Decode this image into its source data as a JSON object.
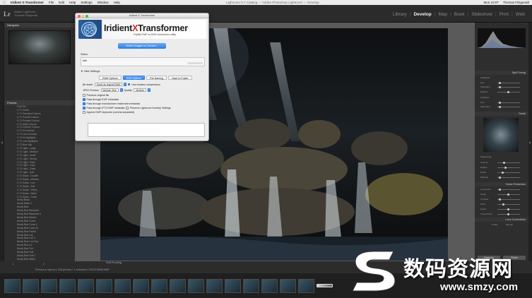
{
  "menubar": {
    "app": "Iridient X-Transformer",
    "items": [
      "File",
      "Edit",
      "Help",
      "Settings",
      "Window",
      "Help"
    ],
    "center": "Lightroom 5.7 Catalog — Adobe Photoshop Lightroom — Develop",
    "clock": "Mon 10:07",
    "user": "Thomas Fitzgerald"
  },
  "lightroom": {
    "logo": "Lr",
    "user_line1": "Adobe Lightroom",
    "user_line2": "Thomas Fitzgerald",
    "modules": [
      "Library",
      "Develop",
      "Map",
      "Book",
      "Slideshow",
      "Print",
      "Web"
    ],
    "active_module": "Develop",
    "left_panel": {
      "navigator_title": "Navigator",
      "presets_title": "Presets",
      "presets": [
        "Fuji Film",
        "X-T1 Velvia",
        "X-T1 Standard Colours",
        "X-T1 Portrait Colours",
        "X-T1 Pushed Colours",
        "X-T1 Astia Colours",
        "X-T1 Chrome Colours",
        "X-T1 Hi Contrast",
        "X-T1 Low Contrast",
        "X-T1 Hi Highlights",
        "X-T1 Low Highlights",
        "X-T1 Blue Sky",
        "X-T1 Light - Large",
        "X-T1 Light - Medium",
        "X-T1 Light - Small",
        "X-T1 Light - Strong",
        "X-T1 Light - Fade",
        "X-T1 Light - Grey",
        "X-T1 Light - Grain",
        "X-T1 Light - Soft",
        "X-T1 Sepia - Double",
        "X-T1 Sepia - Medium",
        "X-T1 Sepia - Low",
        "X-T1 Sepia - Soft",
        "X-T1 Sepia - Yellow",
        "X-T1 Sepia - Warm",
        "X-T1 Sepia - Cross",
        "Newly Black",
        "Newly Black II",
        "Newly Blue",
        "Newly Blue Bleached",
        "Newly Blue Bleached II",
        "Newly Blue Bleach",
        "Newly Blue Curve",
        "Newly Blue Curve II",
        "Newly Blue Curve III",
        "Newly Blue Faded",
        "Newly Blue Lab",
        "Newly Blue Lab II",
        "Newly Blue Low Key",
        "Newly Blue Lit",
        "Newly Blue Tint",
        "Newly Blue Soft",
        "Newly Blue Soft II",
        "Newly Blue Warm"
      ],
      "copy_button": "Copy...",
      "paste_button": "Paste"
    },
    "right_panel": {
      "histogram_title": "Histogram",
      "split_toning": "Split Toning",
      "detail": "Detail",
      "lens_corrections": "Lens Corrections",
      "noise_reduction": "Noise Reduction",
      "profile_tab": "Profile",
      "manual_tab": "Manual",
      "previous_button": "Previous",
      "reset_button": "Reset",
      "slider_labels": [
        "Highlights",
        "Hue",
        "Saturation",
        "Balance",
        "Shadows",
        "Hue",
        "Saturation"
      ],
      "detail_labels": [
        "Sharpening",
        "Amount",
        "Radius",
        "Detail",
        "Masking"
      ],
      "noise_labels": [
        "Luminance",
        "Detail",
        "Contrast",
        "Color",
        "Detail",
        "Smoothness"
      ]
    },
    "filmstrip": {
      "left_label": "1",
      "right_label": "2",
      "crumb": "Previous Import  |  138 photos / 1 selected / DSCF0098.RAF",
      "soft_proofing": "Soft Proofing",
      "thumbnail_count": 18,
      "selected_index": 17
    }
  },
  "dialog": {
    "title": "Iridient X-Transformer",
    "brand_part1": "Iridient",
    "brand_x": "X",
    "brand_part2": "Transformer",
    "tagline": "Fujifilm RAF to DNG conversion utility",
    "select_button": "Select Images to Convert...",
    "status_label": "Status",
    "status_value": "Idle",
    "hide_settings": "Hide Settings",
    "tabs": [
      "RAW Options",
      "DNG Options",
      "File Naming",
      "Save to Folder"
    ],
    "active_tab": "DNG Options",
    "bit_depth_label": "Bit depth:",
    "bit_depth_value": "Same as original RAW",
    "lossless_label": "Use lossless compression",
    "jpeg_preview_label": "JPEG Preview:",
    "jpeg_preview_value": "Medium Size",
    "quality_label": "Quality:",
    "quality_value": "Medium",
    "preserve_label": "Preserve original file",
    "pass_exif": "Pass-through EXIF metadata",
    "pass_makernote": "Pass-through manufacturer makernote metadata",
    "pass_iptc": "Pass-through IPTC/XMP metadata",
    "preserve_lr": "Preserve Lightroom Develop Settings",
    "append_kw": "Append XMP keywords (comma separated)"
  },
  "watermark": {
    "cn": "数码资源网",
    "url": "www.smzy.com"
  },
  "colors": {
    "accent": "#2f7de0",
    "brand_x": "#d42a2a"
  }
}
